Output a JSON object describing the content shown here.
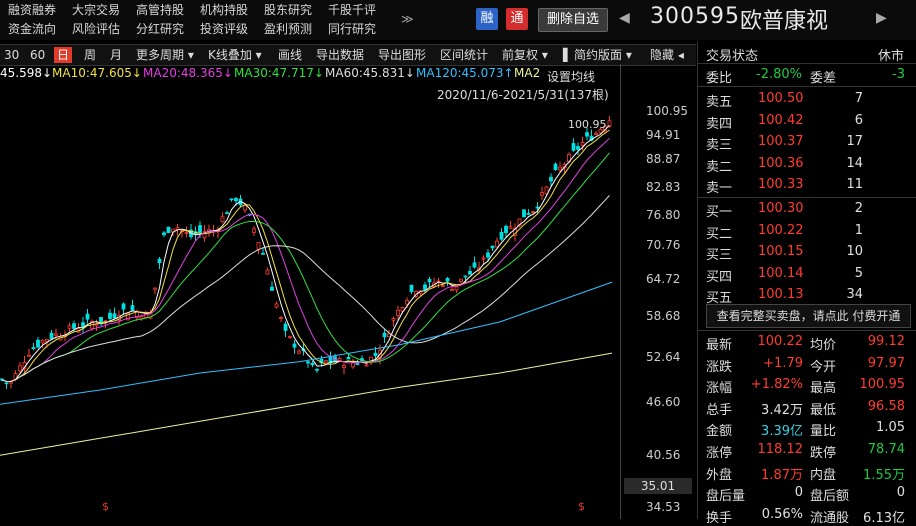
{
  "topnav": {
    "row1": [
      "融资融券",
      "大宗交易",
      "高管持股",
      "机构持股",
      "股东研究",
      "千股千评"
    ],
    "row2": [
      "资金流向",
      "风险评估",
      "分红研究",
      "投资评级",
      "盈利预测",
      "同行研究"
    ],
    "more": "≫",
    "tag_rong": "融",
    "tag_tong": "通",
    "remove_fav": "删除自选",
    "prev_arrow": "◀",
    "next_arrow": "▶",
    "stock_code": "300595",
    "stock_name": "欧普康视"
  },
  "toolbar": {
    "items": [
      "30",
      "60",
      "日",
      "周",
      "月",
      "更多周期 ▾",
      "K线叠加 ▾",
      "画线",
      "导出数据",
      "导出图形",
      "区间统计",
      "前复权 ▾",
      "▌",
      "简约版面 ▾",
      "隐藏 ◂"
    ],
    "active_index": 2
  },
  "ma_legend": [
    {
      "text": "45.598↓",
      "color": "#ffffff"
    },
    {
      "text": "MA10:47.605↓",
      "color": "#f0e040"
    },
    {
      "text": "MA20:48.365↓",
      "color": "#e040e0"
    },
    {
      "text": "MA30:47.717↓",
      "color": "#30e040"
    },
    {
      "text": "MA60:45.831↓",
      "color": "#dddddd"
    },
    {
      "text": "MA120:45.073↑",
      "color": "#30c0ff"
    },
    {
      "text": "MA2",
      "color": "#f0f0a0"
    }
  ],
  "set_ma": "设置均线",
  "range_label": "2020/11/6-2021/5/31(137根)",
  "price_high_label": "100.95",
  "price_ticks": [
    "100.95",
    "94.91",
    "88.87",
    "82.83",
    "76.80",
    "70.76",
    "64.72",
    "58.68",
    "52.64",
    "46.60",
    "40.56"
  ],
  "axis_current": "35.01",
  "axis_bottom": "34.53",
  "colors": {
    "up": "#ff3b30",
    "down": "#00e0e0",
    "accent": "#e03b2b"
  },
  "panel": {
    "title": "交易状态",
    "status": "休市",
    "weibi_label": "委比",
    "weibi_value": "-2.80%",
    "weicha_label": "委差",
    "weicha_value": "-3",
    "asks": [
      {
        "label": "卖五",
        "price": "100.50",
        "vol": "7"
      },
      {
        "label": "卖四",
        "price": "100.42",
        "vol": "6"
      },
      {
        "label": "卖三",
        "price": "100.37",
        "vol": "17"
      },
      {
        "label": "卖二",
        "price": "100.36",
        "vol": "14"
      },
      {
        "label": "卖一",
        "price": "100.33",
        "vol": "11"
      }
    ],
    "bids": [
      {
        "label": "买一",
        "price": "100.30",
        "vol": "2"
      },
      {
        "label": "买二",
        "price": "100.22",
        "vol": "1"
      },
      {
        "label": "买三",
        "price": "100.15",
        "vol": "10"
      },
      {
        "label": "买四",
        "price": "100.14",
        "vol": "5"
      },
      {
        "label": "买五",
        "price": "100.13",
        "vol": "34"
      }
    ],
    "buy_more": "查看完整买卖盘，请点此 付费开通",
    "stats": [
      {
        "l1": "最新",
        "v1": "100.22",
        "c1": "red",
        "l2": "均价",
        "v2": "99.12",
        "c2": "red"
      },
      {
        "l1": "涨跌",
        "v1": "+1.79",
        "c1": "red",
        "l2": "今开",
        "v2": "97.97",
        "c2": "red"
      },
      {
        "l1": "涨幅",
        "v1": "+1.82%",
        "c1": "red",
        "l2": "最高",
        "v2": "100.95",
        "c2": "red"
      },
      {
        "l1": "总手",
        "v1": "3.42万",
        "c1": "white",
        "l2": "最低",
        "v2": "96.58",
        "c2": "red"
      },
      {
        "l1": "金额",
        "v1": "3.39亿",
        "c1": "cyan",
        "l2": "量比",
        "v2": "1.05",
        "c2": "white"
      },
      {
        "l1": "涨停",
        "v1": "118.12",
        "c1": "red",
        "l2": "跌停",
        "v2": "78.74",
        "c2": "green"
      },
      {
        "l1": "外盘",
        "v1": "1.87万",
        "c1": "red",
        "l2": "内盘",
        "v2": "1.55万",
        "c2": "green"
      },
      {
        "l1": "盘后量",
        "v1": "0",
        "c1": "white",
        "l2": "盘后额",
        "v2": "0",
        "c2": "white"
      },
      {
        "l1": "换手",
        "v1": "0.56%",
        "c1": "white",
        "l2": "流通股",
        "v2": "6.13亿",
        "c2": "white"
      }
    ]
  }
}
